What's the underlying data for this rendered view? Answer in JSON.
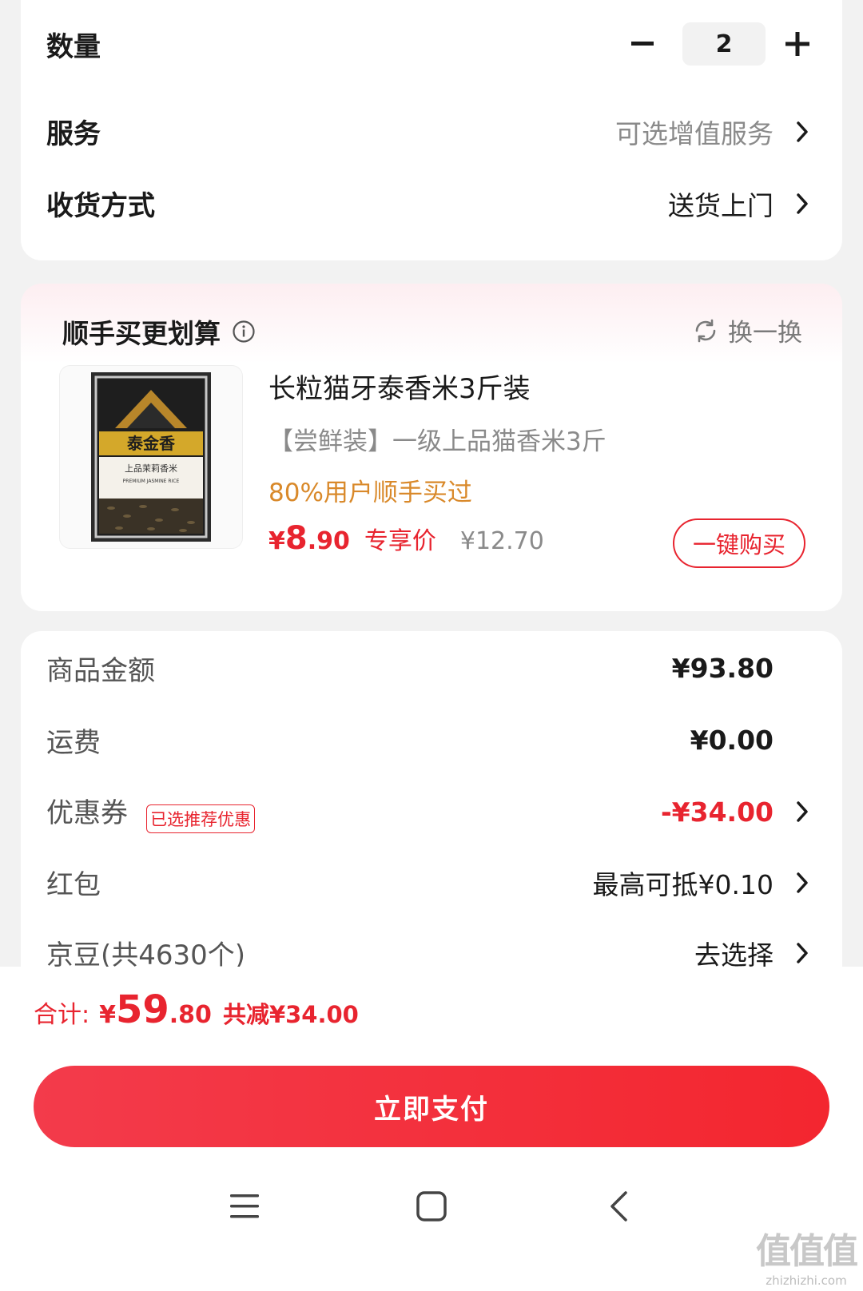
{
  "order": {
    "quantity_label": "数量",
    "quantity_value": "2",
    "service_label": "服务",
    "service_value": "可选增值服务",
    "delivery_label": "收货方式",
    "delivery_value": "送货上门"
  },
  "addon": {
    "title": "顺手买更划算",
    "swap_label": "换一换",
    "product": {
      "title": "长粒猫牙泰香米3斤装",
      "subtitle": "【尝鲜装】一级上品猫香米3斤",
      "hint": "80%用户顺手买过",
      "price_currency": "¥",
      "price_int": "8",
      "price_dec": ".90",
      "price_tag": "专享价",
      "original_price": "¥12.70",
      "buy_label": "一键购买",
      "package_brand": "泰金香",
      "package_line1": "上品茉莉香米",
      "package_line2": "PREMIUM JASMINE RICE"
    }
  },
  "summary": {
    "goods_label": "商品金额",
    "goods_value": "¥93.80",
    "shipping_label": "运费",
    "shipping_value": "¥0.00",
    "coupon_label": "优惠券",
    "coupon_badge": "已选推荐优惠",
    "coupon_value": "-¥34.00",
    "redpacket_label": "红包",
    "redpacket_value": "最高可抵¥0.10",
    "jingdou_label": "京豆(共4630个)",
    "jingdou_value": "去选择"
  },
  "footer": {
    "total_label": "合计:",
    "total_currency": "¥",
    "total_int": "59",
    "total_dec": ".80",
    "total_saving": "共减¥34.00",
    "pay_label": "立即支付"
  },
  "watermark": {
    "big": "值值值",
    "small": "zhizhizhi.com"
  },
  "colors": {
    "accent_red": "#e8242f",
    "hint_orange": "#d9892a",
    "muted_gray": "#8a8a8a"
  },
  "icons": [
    "minus-icon",
    "plus-icon",
    "chevron-right-icon",
    "info-icon",
    "refresh-icon",
    "menu-icon",
    "home-icon",
    "back-icon"
  ]
}
